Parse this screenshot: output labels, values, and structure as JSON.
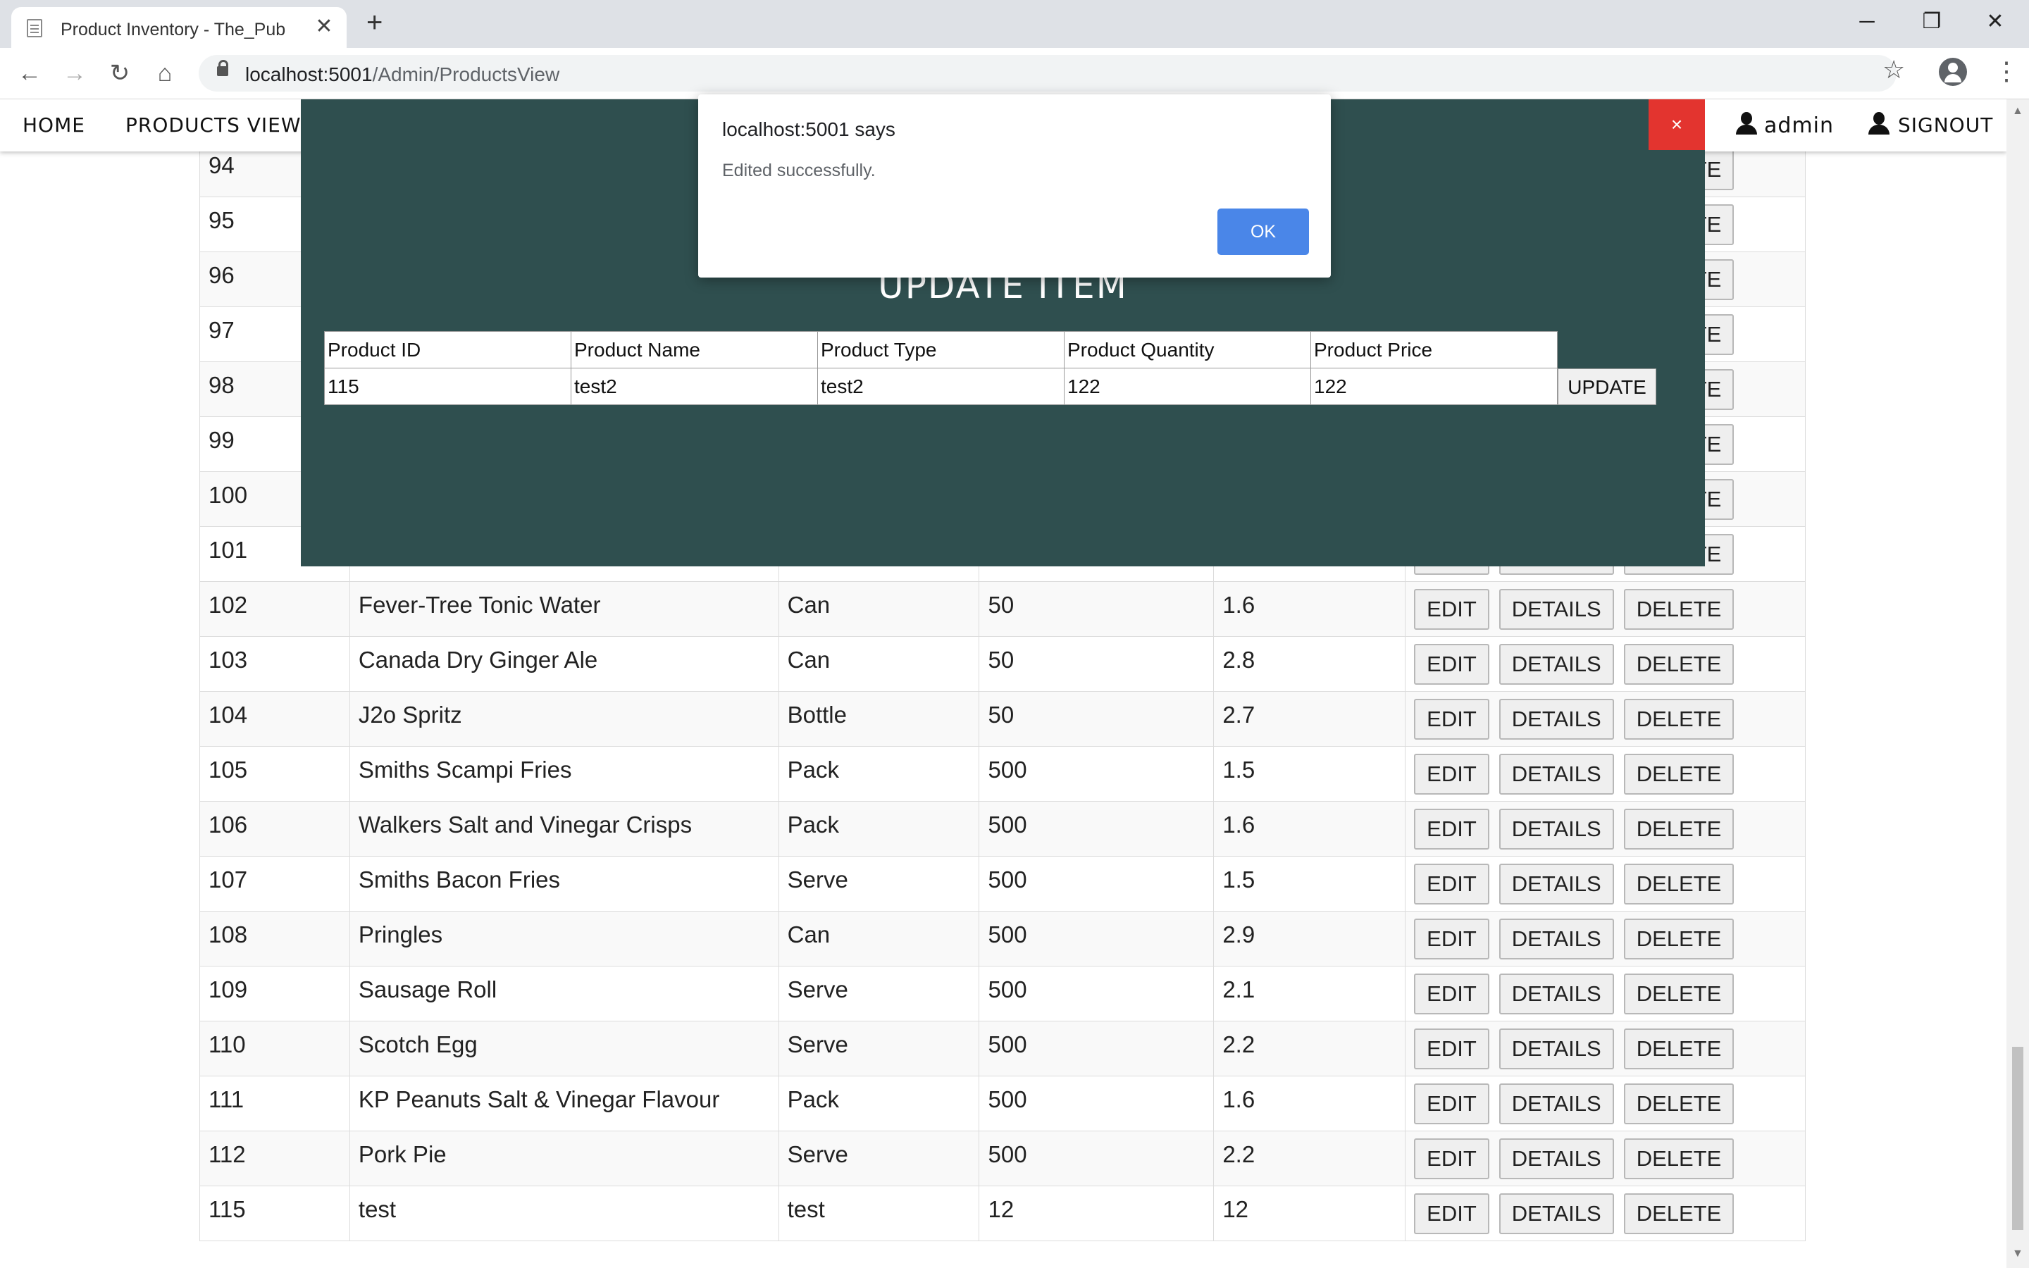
{
  "browser": {
    "tab_title": "Product Inventory - The_Pub",
    "new_tab_symbol": "+",
    "close_symbol": "✕",
    "url_host": "localhost:5001",
    "url_path": "/Admin/ProductsView",
    "window_minimize": "─",
    "window_restore": "❐",
    "window_close": "✕"
  },
  "nav": {
    "home": "HOME",
    "products_view": "PRODUCTS VIEW",
    "user": "admin",
    "signout": "SIGNOUT"
  },
  "table": {
    "rows": [
      {
        "id": "94",
        "name": "",
        "type": "",
        "qty": "",
        "price": ""
      },
      {
        "id": "95",
        "name": "",
        "type": "",
        "qty": "",
        "price": ""
      },
      {
        "id": "96",
        "name": "",
        "type": "",
        "qty": "",
        "price": ""
      },
      {
        "id": "97",
        "name": "",
        "type": "",
        "qty": "",
        "price": ""
      },
      {
        "id": "98",
        "name": "",
        "type": "",
        "qty": "",
        "price": ""
      },
      {
        "id": "99",
        "name": "",
        "type": "",
        "qty": "",
        "price": ""
      },
      {
        "id": "100",
        "name": "",
        "type": "",
        "qty": "",
        "price": ""
      },
      {
        "id": "101",
        "name": "",
        "type": "",
        "qty": "",
        "price": ""
      },
      {
        "id": "102",
        "name": "Fever-Tree Tonic Water",
        "type": "Can",
        "qty": "50",
        "price": "1.6"
      },
      {
        "id": "103",
        "name": "Canada Dry Ginger Ale",
        "type": "Can",
        "qty": "50",
        "price": "2.8"
      },
      {
        "id": "104",
        "name": "J2o Spritz",
        "type": "Bottle",
        "qty": "50",
        "price": "2.7"
      },
      {
        "id": "105",
        "name": "Smiths Scampi Fries",
        "type": "Pack",
        "qty": "500",
        "price": "1.5"
      },
      {
        "id": "106",
        "name": "Walkers Salt and Vinegar Crisps",
        "type": "Pack",
        "qty": "500",
        "price": "1.6"
      },
      {
        "id": "107",
        "name": "Smiths Bacon Fries",
        "type": "Serve",
        "qty": "500",
        "price": "1.5"
      },
      {
        "id": "108",
        "name": "Pringles",
        "type": "Can",
        "qty": "500",
        "price": "2.9"
      },
      {
        "id": "109",
        "name": "Sausage Roll",
        "type": "Serve",
        "qty": "500",
        "price": "2.1"
      },
      {
        "id": "110",
        "name": "Scotch Egg",
        "type": "Serve",
        "qty": "500",
        "price": "2.2"
      },
      {
        "id": "111",
        "name": "KP Peanuts Salt & Vinegar Flavour",
        "type": "Pack",
        "qty": "500",
        "price": "1.6"
      },
      {
        "id": "112",
        "name": "Pork Pie",
        "type": "Serve",
        "qty": "500",
        "price": "2.2"
      },
      {
        "id": "115",
        "name": "test",
        "type": "test",
        "qty": "12",
        "price": "12"
      }
    ],
    "edit_label": "EDIT",
    "details_label": "DETAILS",
    "delete_label": "DELETE"
  },
  "modal": {
    "close_symbol": "×",
    "title": "UPDATE ITEM",
    "headers": [
      "Product ID",
      "Product Name",
      "Product Type",
      "Product Quantity",
      "Product Price"
    ],
    "values": [
      "115",
      "test2",
      "test2",
      "122",
      "122"
    ],
    "update_label": "UPDATE"
  },
  "alert": {
    "title": "localhost:5001 says",
    "message": "Edited successfully.",
    "ok_label": "OK"
  },
  "colors": {
    "modal_bg": "#2f4f4f",
    "close_btn": "#e3342f",
    "ok_btn": "#4a86e8"
  }
}
